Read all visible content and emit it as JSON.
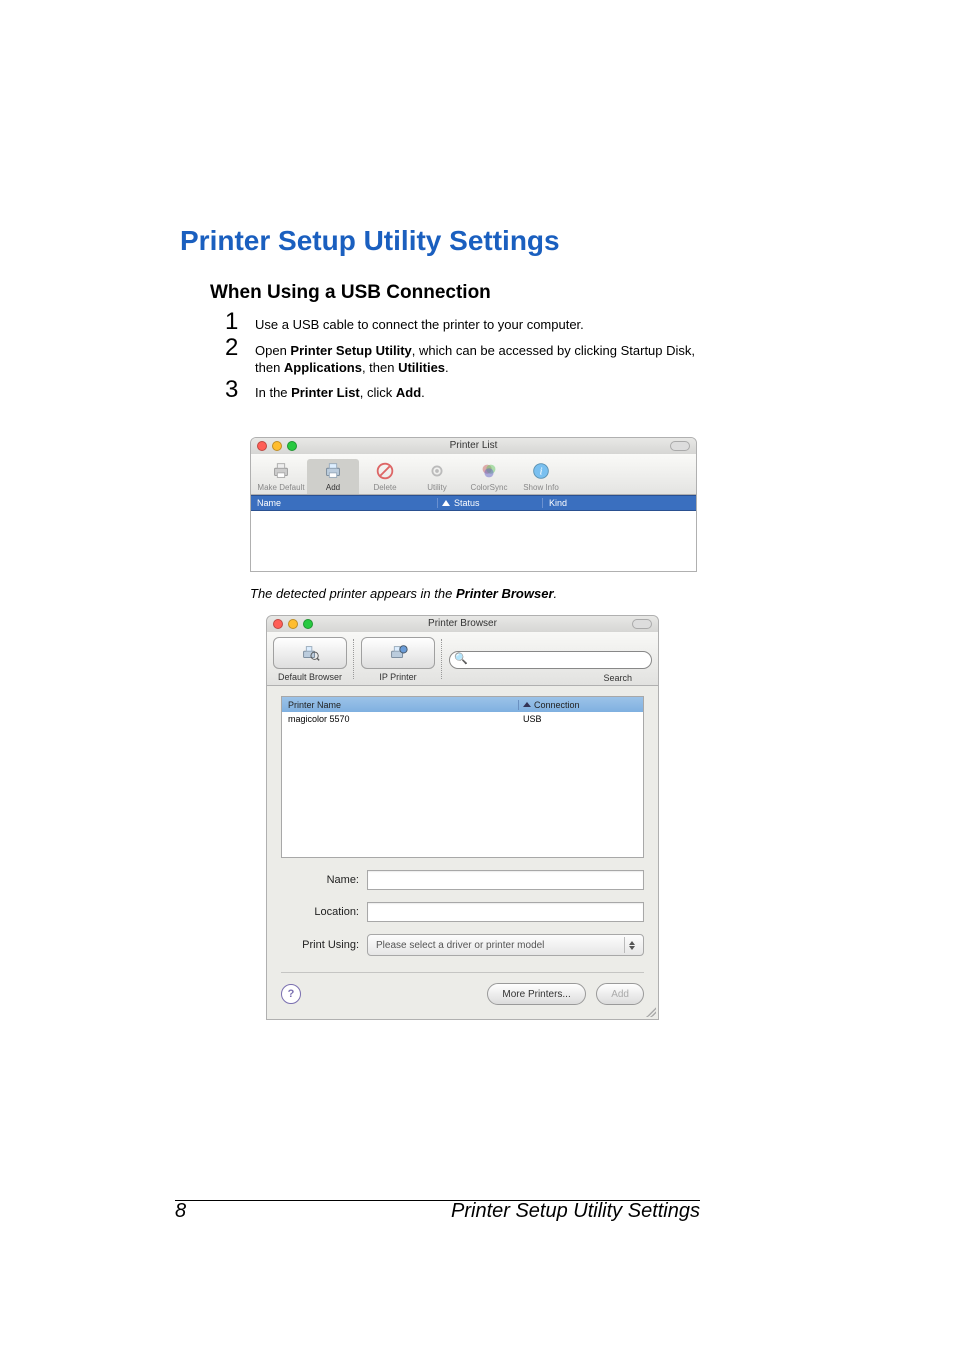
{
  "title": "Printer Setup Utility Settings",
  "subheading": "When Using a USB Connection",
  "steps": {
    "s1": {
      "num": "1",
      "text": "Use a USB cable to connect the printer to your computer."
    },
    "s2": {
      "num": "2",
      "text_pre": "Open ",
      "b1": "Printer Setup Utility",
      "text_mid": ", which can be accessed by clicking Startup Disk, then ",
      "b2": "Applications",
      "text_mid2": ", then ",
      "b3": "Utilities",
      "text_end": "."
    },
    "s3": {
      "num": "3",
      "text_pre": "In the ",
      "b1": "Printer List",
      "text_mid": ", click ",
      "b2": "Add",
      "text_end": "."
    }
  },
  "win1": {
    "title": "Printer List",
    "toolbar": {
      "make_default": "Make Default",
      "add": "Add",
      "delete": "Delete",
      "utility": "Utility",
      "colorsync": "ColorSync",
      "show_info": "Show Info"
    },
    "columns": {
      "name": "Name",
      "status": "Status",
      "kind": "Kind"
    }
  },
  "caption2_pre": "The detected printer appears in the ",
  "caption2_b": "Printer Browser",
  "caption2_end": ".",
  "win2": {
    "title": "Printer Browser",
    "toolbar": {
      "default_browser": "Default Browser",
      "ip_printer": "IP Printer",
      "search": "Search",
      "search_placeholder": ""
    },
    "listheader": {
      "printer_name": "Printer Name",
      "connection": "Connection"
    },
    "row": {
      "name": "magicolor 5570",
      "conn": "USB"
    },
    "form": {
      "name_label": "Name:",
      "location_label": "Location:",
      "print_using_label": "Print Using:",
      "print_using_value": "Please select a driver or printer model"
    },
    "buttons": {
      "help": "?",
      "more_printers": "More Printers...",
      "add": "Add"
    }
  },
  "footer": {
    "page": "8",
    "title": "Printer Setup Utility Settings"
  }
}
